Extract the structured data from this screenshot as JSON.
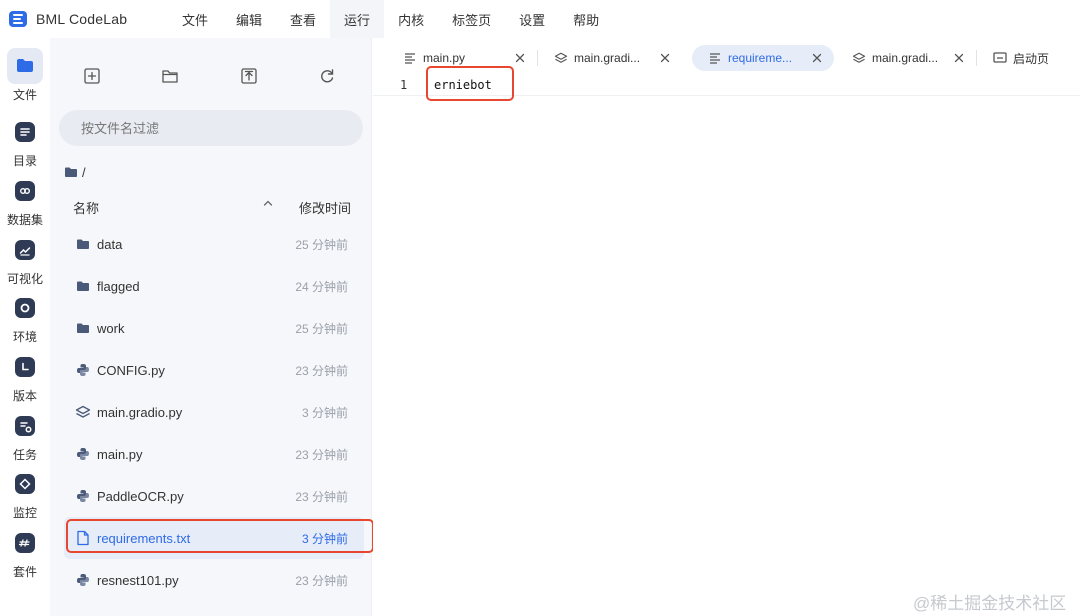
{
  "app": {
    "name": "BML CodeLab",
    "menu": [
      "文件",
      "编辑",
      "查看",
      "运行",
      "内核",
      "标签页",
      "设置",
      "帮助"
    ],
    "active_menu": "运行"
  },
  "rail": [
    {
      "label": "文件",
      "icon": "folder-icon",
      "active": true
    },
    {
      "label": "目录",
      "icon": "list-icon"
    },
    {
      "label": "数据集",
      "icon": "dataset-icon"
    },
    {
      "label": "可视化",
      "icon": "chart-icon"
    },
    {
      "label": "环境",
      "icon": "environment-icon"
    },
    {
      "label": "版本",
      "icon": "clock-icon"
    },
    {
      "label": "任务",
      "icon": "task-icon"
    },
    {
      "label": "监控",
      "icon": "monitor-icon"
    },
    {
      "label": "套件",
      "icon": "suite-icon"
    }
  ],
  "file_panel": {
    "search_placeholder": "按文件名过滤",
    "breadcrumb": "/",
    "col_name": "名称",
    "col_time": "修改时间",
    "files": [
      {
        "name": "data",
        "type": "folder",
        "time": "25 分钟前"
      },
      {
        "name": "flagged",
        "type": "folder",
        "time": "24 分钟前"
      },
      {
        "name": "work",
        "type": "folder",
        "time": "25 分钟前"
      },
      {
        "name": "CONFIG.py",
        "type": "python",
        "time": "23 分钟前"
      },
      {
        "name": "main.gradio.py",
        "type": "gradio",
        "time": "3 分钟前"
      },
      {
        "name": "main.py",
        "type": "python",
        "time": "23 分钟前"
      },
      {
        "name": "PaddleOCR.py",
        "type": "python",
        "time": "23 分钟前"
      },
      {
        "name": "requirements.txt",
        "type": "text",
        "time": "3 分钟前",
        "selected": true
      },
      {
        "name": "resnest101.py",
        "type": "python",
        "time": "23 分钟前"
      }
    ]
  },
  "editor": {
    "tabs": [
      {
        "label": "main.py",
        "icon": "lines-icon"
      },
      {
        "label": "main.gradi...",
        "icon": "layers-icon"
      },
      {
        "label": "requireme...",
        "icon": "lines-icon",
        "active": true
      },
      {
        "label": "main.gradi...",
        "icon": "layers-icon"
      },
      {
        "label": "启动页",
        "icon": "launcher-icon"
      }
    ],
    "lines": [
      {
        "no": "1",
        "text": "erniebot"
      }
    ]
  },
  "watermark": "@稀土掘金技术社区",
  "colors": {
    "accent": "#2e6be6",
    "highlight": "#e8472f",
    "panel_bg": "#f6f7fa"
  }
}
